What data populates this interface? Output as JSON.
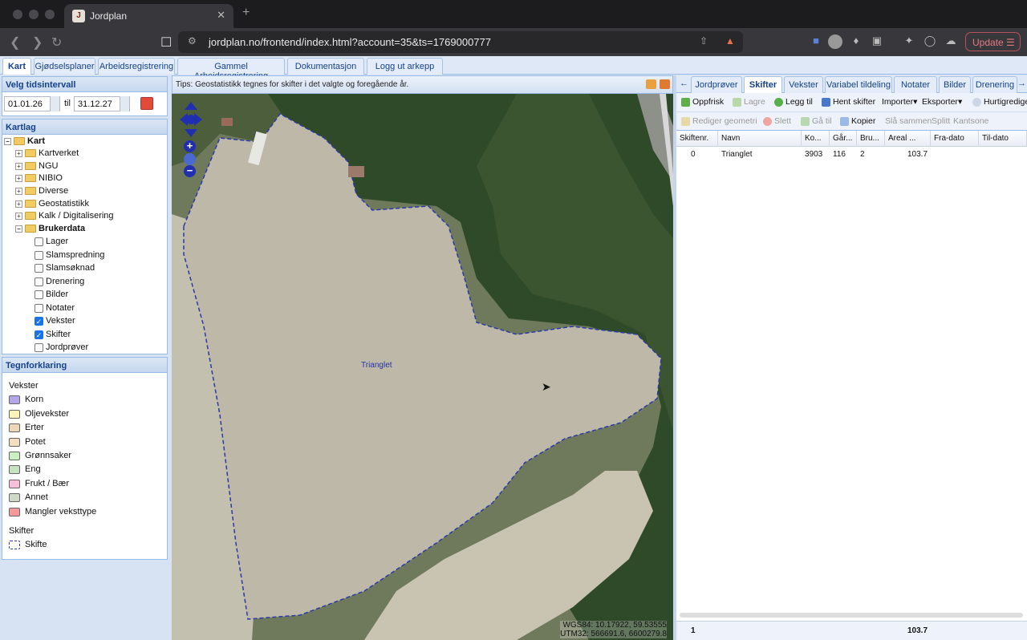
{
  "browser": {
    "tab_title": "Jordplan",
    "favicon": "J",
    "url": "jordplan.no/frontend/index.html?account=35&ts=1769000777",
    "update_label": "Update"
  },
  "app_tabs": [
    "Kart",
    "Gjødselsplaner",
    "Arbeidsregistrering",
    "Gammel Arbeidsregistrering",
    "Dokumentasjon",
    "Logg ut arkepp"
  ],
  "left": {
    "time_header": "Velg tidsintervall",
    "from_date": "01.01.26",
    "til_label": "til",
    "to_date": "31.12.27",
    "layers_header": "Kartlag",
    "tree": [
      {
        "label": "Kart"
      },
      {
        "label": "Kartverket"
      },
      {
        "label": "NGU"
      },
      {
        "label": "NIBIO"
      },
      {
        "label": "Diverse"
      },
      {
        "label": "Geostatistikk"
      },
      {
        "label": "Kalk / Digitalisering"
      },
      {
        "label": "Brukerdata"
      },
      {
        "label": "Lager",
        "checked": false
      },
      {
        "label": "Slamspredning",
        "checked": false
      },
      {
        "label": "Slamsøknad",
        "checked": false
      },
      {
        "label": "Drenering",
        "checked": false
      },
      {
        "label": "Bilder",
        "checked": false
      },
      {
        "label": "Notater",
        "checked": false
      },
      {
        "label": "Vekster",
        "checked": true
      },
      {
        "label": "Skifter",
        "checked": true
      },
      {
        "label": "Jordprøver",
        "checked": false
      }
    ],
    "legend_header": "Tegnforklaring",
    "legend_group1": "Vekster",
    "legend_items": [
      {
        "label": "Korn",
        "color": "#b3a6e8"
      },
      {
        "label": "Oljevekster",
        "color": "#fbf3b8"
      },
      {
        "label": "Erter",
        "color": "#ecd8b8"
      },
      {
        "label": "Potet",
        "color": "#f2dfbf"
      },
      {
        "label": "Grønnsaker",
        "color": "#c9f0c0"
      },
      {
        "label": "Eng",
        "color": "#c7e2c0"
      },
      {
        "label": "Frukt / Bær",
        "color": "#f7bfd8"
      },
      {
        "label": "Annet",
        "color": "#cfd9c8"
      },
      {
        "label": "Mangler veksttype",
        "color": "#f49a9a"
      }
    ],
    "legend_group2": "Skifter",
    "legend_skifte": "Skifte"
  },
  "map": {
    "tip": "Tips: Geostatistikk tegnes for skifter i det valgte og foregående år.",
    "field_label": "Trianglet",
    "wgs": "WGS84: 10.17922, 59.53555",
    "utm": "UTM32: 566691.6, 6600279.8"
  },
  "right": {
    "tabs": [
      "Jordprøver",
      "Skifter",
      "Vekster",
      "Variabel tildeling",
      "Notater",
      "Bilder",
      "Drenering"
    ],
    "toolbar1": [
      "Oppfrisk",
      "Lagre",
      "Legg til",
      "Hent skifter",
      "Importer",
      "Eksporter",
      "Hurtigredige"
    ],
    "toolbar2": [
      "Rediger geometri",
      "Slett",
      "Gå til",
      "Kopier",
      "Slå sammen",
      "Splitt",
      "Kantsone"
    ],
    "columns": [
      "Skiftenr.",
      "Navn",
      "Ko...",
      "Går...",
      "Bru...",
      "Areal ...",
      "Fra-dato",
      "Til-dato"
    ],
    "rows": [
      [
        "0",
        "Trianglet",
        "3903",
        "116",
        "2",
        "103.7",
        "",
        ""
      ]
    ],
    "footer_count": "1",
    "footer_area": "103.7"
  }
}
